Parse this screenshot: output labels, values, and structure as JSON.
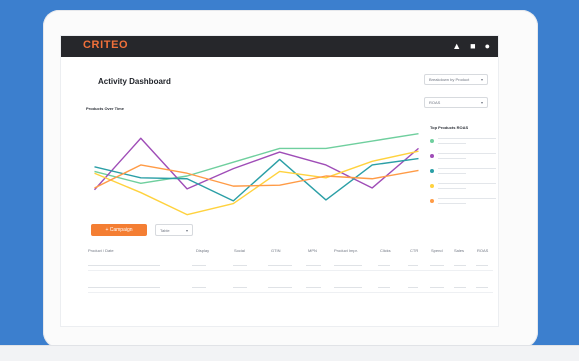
{
  "app": {
    "logo": "CRITEO",
    "topbar_icons": [
      "bell-icon",
      "doc-icon",
      "user-icon"
    ]
  },
  "dashboard": {
    "title": "Activity Dashboard",
    "breakdown_dropdown": "Breakdown by Product",
    "metric_dropdown": "ROAS",
    "chart_title": "Products Over Time",
    "top_products_title": "Top Products ROAS",
    "campaign_button": "+ Campaign",
    "view_dropdown": "Table"
  },
  "table": {
    "columns": [
      "Product / Date",
      "Display",
      "Social",
      "GTIN",
      "MPN",
      "Product Impr.",
      "Clicks",
      "CTR",
      "Spend",
      "Sales",
      "ROAS"
    ],
    "rows": [
      {
        "placeholder": true
      },
      {
        "placeholder": true
      }
    ]
  },
  "chart_data": {
    "type": "line",
    "x": [
      1,
      2,
      3,
      4,
      5,
      6,
      7,
      8
    ],
    "series": [
      {
        "color": "#6fcf9e",
        "values": [
          5.5,
          4.2,
          5.0,
          6.5,
          8.0,
          8.0,
          8.8,
          9.6
        ]
      },
      {
        "color": "#9f4db7",
        "values": [
          3.5,
          9.1,
          3.6,
          5.8,
          7.6,
          6.2,
          3.7,
          8.0
        ]
      },
      {
        "color": "#2b9fa6",
        "values": [
          6.0,
          4.8,
          4.7,
          2.3,
          6.8,
          2.4,
          6.2,
          6.9
        ]
      },
      {
        "color": "#ffd23e",
        "values": [
          5.3,
          3.2,
          0.8,
          2.0,
          5.5,
          4.8,
          6.6,
          7.7
        ]
      },
      {
        "color": "#ff9b46",
        "values": [
          3.7,
          6.2,
          5.3,
          3.9,
          4.0,
          5.0,
          4.7,
          5.6
        ]
      }
    ],
    "xlim": [
      1,
      8
    ],
    "ylim": [
      0,
      10
    ],
    "grid": false,
    "legend": "right"
  }
}
